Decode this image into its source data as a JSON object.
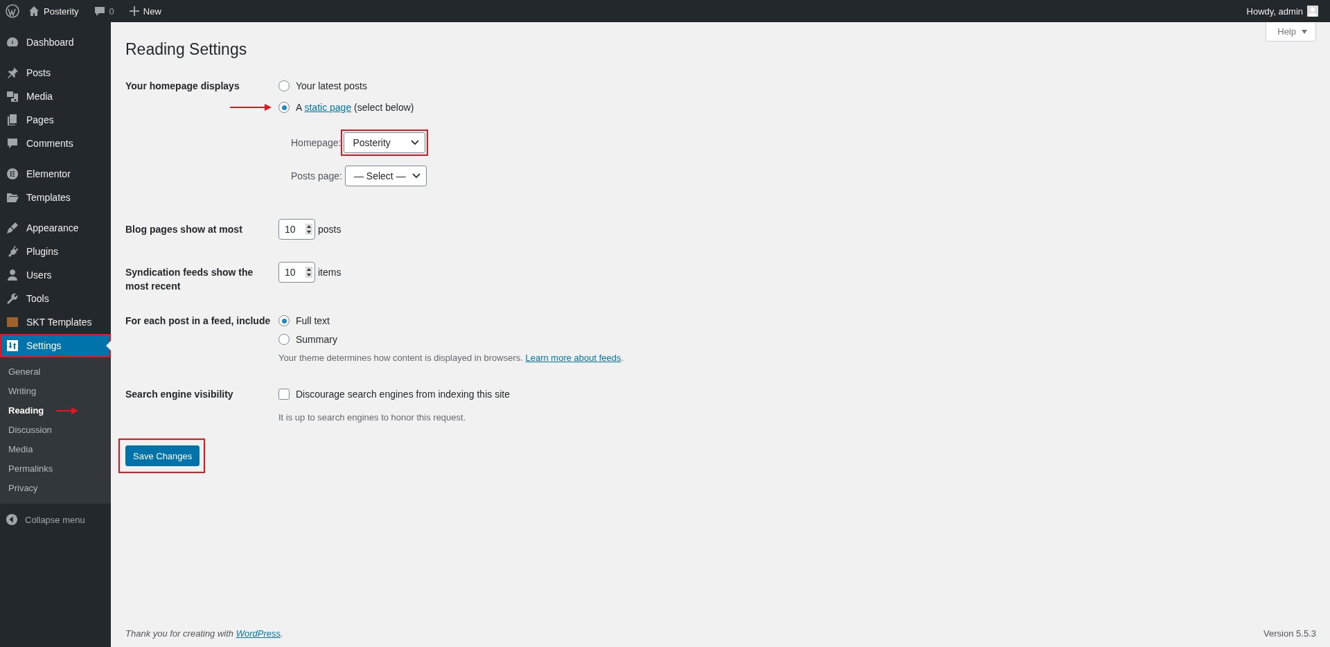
{
  "admin_bar": {
    "site_name": "Posterity",
    "comments_count": "0",
    "new_label": "New",
    "greeting": "Howdy, admin"
  },
  "sidebar": {
    "groups": [
      [
        {
          "label": "Dashboard",
          "selected": false,
          "highlighted": false
        }
      ],
      [
        {
          "label": "Posts",
          "selected": false,
          "highlighted": false
        },
        {
          "label": "Media",
          "selected": false,
          "highlighted": false
        },
        {
          "label": "Pages",
          "selected": false,
          "highlighted": false
        },
        {
          "label": "Comments",
          "selected": false,
          "highlighted": false
        }
      ],
      [
        {
          "label": "Elementor",
          "selected": false,
          "highlighted": false
        },
        {
          "label": "Templates",
          "selected": false,
          "highlighted": false
        }
      ],
      [
        {
          "label": "Appearance",
          "selected": false,
          "highlighted": false
        },
        {
          "label": "Plugins",
          "selected": false,
          "highlighted": false
        },
        {
          "label": "Users",
          "selected": false,
          "highlighted": false
        },
        {
          "label": "Tools",
          "selected": false,
          "highlighted": false
        },
        {
          "label": "SKT Templates",
          "selected": false,
          "highlighted": false
        },
        {
          "label": "Settings",
          "selected": true,
          "highlighted": true,
          "submenu": [
            {
              "label": "General",
              "selected": false,
              "arrow": false
            },
            {
              "label": "Writing",
              "selected": false,
              "arrow": false
            },
            {
              "label": "Reading",
              "selected": true,
              "arrow": true
            },
            {
              "label": "Discussion",
              "selected": false,
              "arrow": false
            },
            {
              "label": "Media",
              "selected": false,
              "arrow": false
            },
            {
              "label": "Permalinks",
              "selected": false,
              "arrow": false
            },
            {
              "label": "Privacy",
              "selected": false,
              "arrow": false
            }
          ]
        }
      ]
    ],
    "collapse_label": "Collapse menu"
  },
  "help_button": {
    "label": "Help"
  },
  "page_title": "Reading Settings",
  "homepage_displays": {
    "label": "Your homepage displays",
    "options": [
      {
        "selected": false,
        "arrow": false,
        "text": "Your latest posts"
      },
      {
        "selected": true,
        "arrow": true,
        "prefix": "A",
        "link": "static page",
        "suffix": "(select below)"
      }
    ],
    "selects": [
      {
        "label": "Homepage:",
        "value": "Posterity",
        "highlighted": true
      },
      {
        "label": "Posts page:",
        "value": "— Select —",
        "highlighted": false
      }
    ]
  },
  "blog_pages": {
    "label": "Blog pages show at most",
    "value": "10",
    "unit": "posts"
  },
  "syndication": {
    "label": "Syndication feeds show the most recent",
    "value": "10",
    "unit": "items"
  },
  "feed_content": {
    "label": "For each post in a feed, include",
    "options": [
      {
        "text": "Full text",
        "selected": true
      },
      {
        "text": "Summary",
        "selected": false
      }
    ],
    "description": "Your theme determines how content is displayed in browsers.",
    "link": "Learn more about feeds",
    "link_suffix": "."
  },
  "search_visibility": {
    "label": "Search engine visibility",
    "checkbox_label": "Discourage search engines from indexing this site",
    "checked": false,
    "description": "It is up to search engines to honor this request."
  },
  "save_button": {
    "label": "Save Changes",
    "highlighted": true
  },
  "footer": {
    "prefix": "Thank you for creating with",
    "link": "WordPress",
    "suffix": ".",
    "version": "Version 5.5.3"
  }
}
